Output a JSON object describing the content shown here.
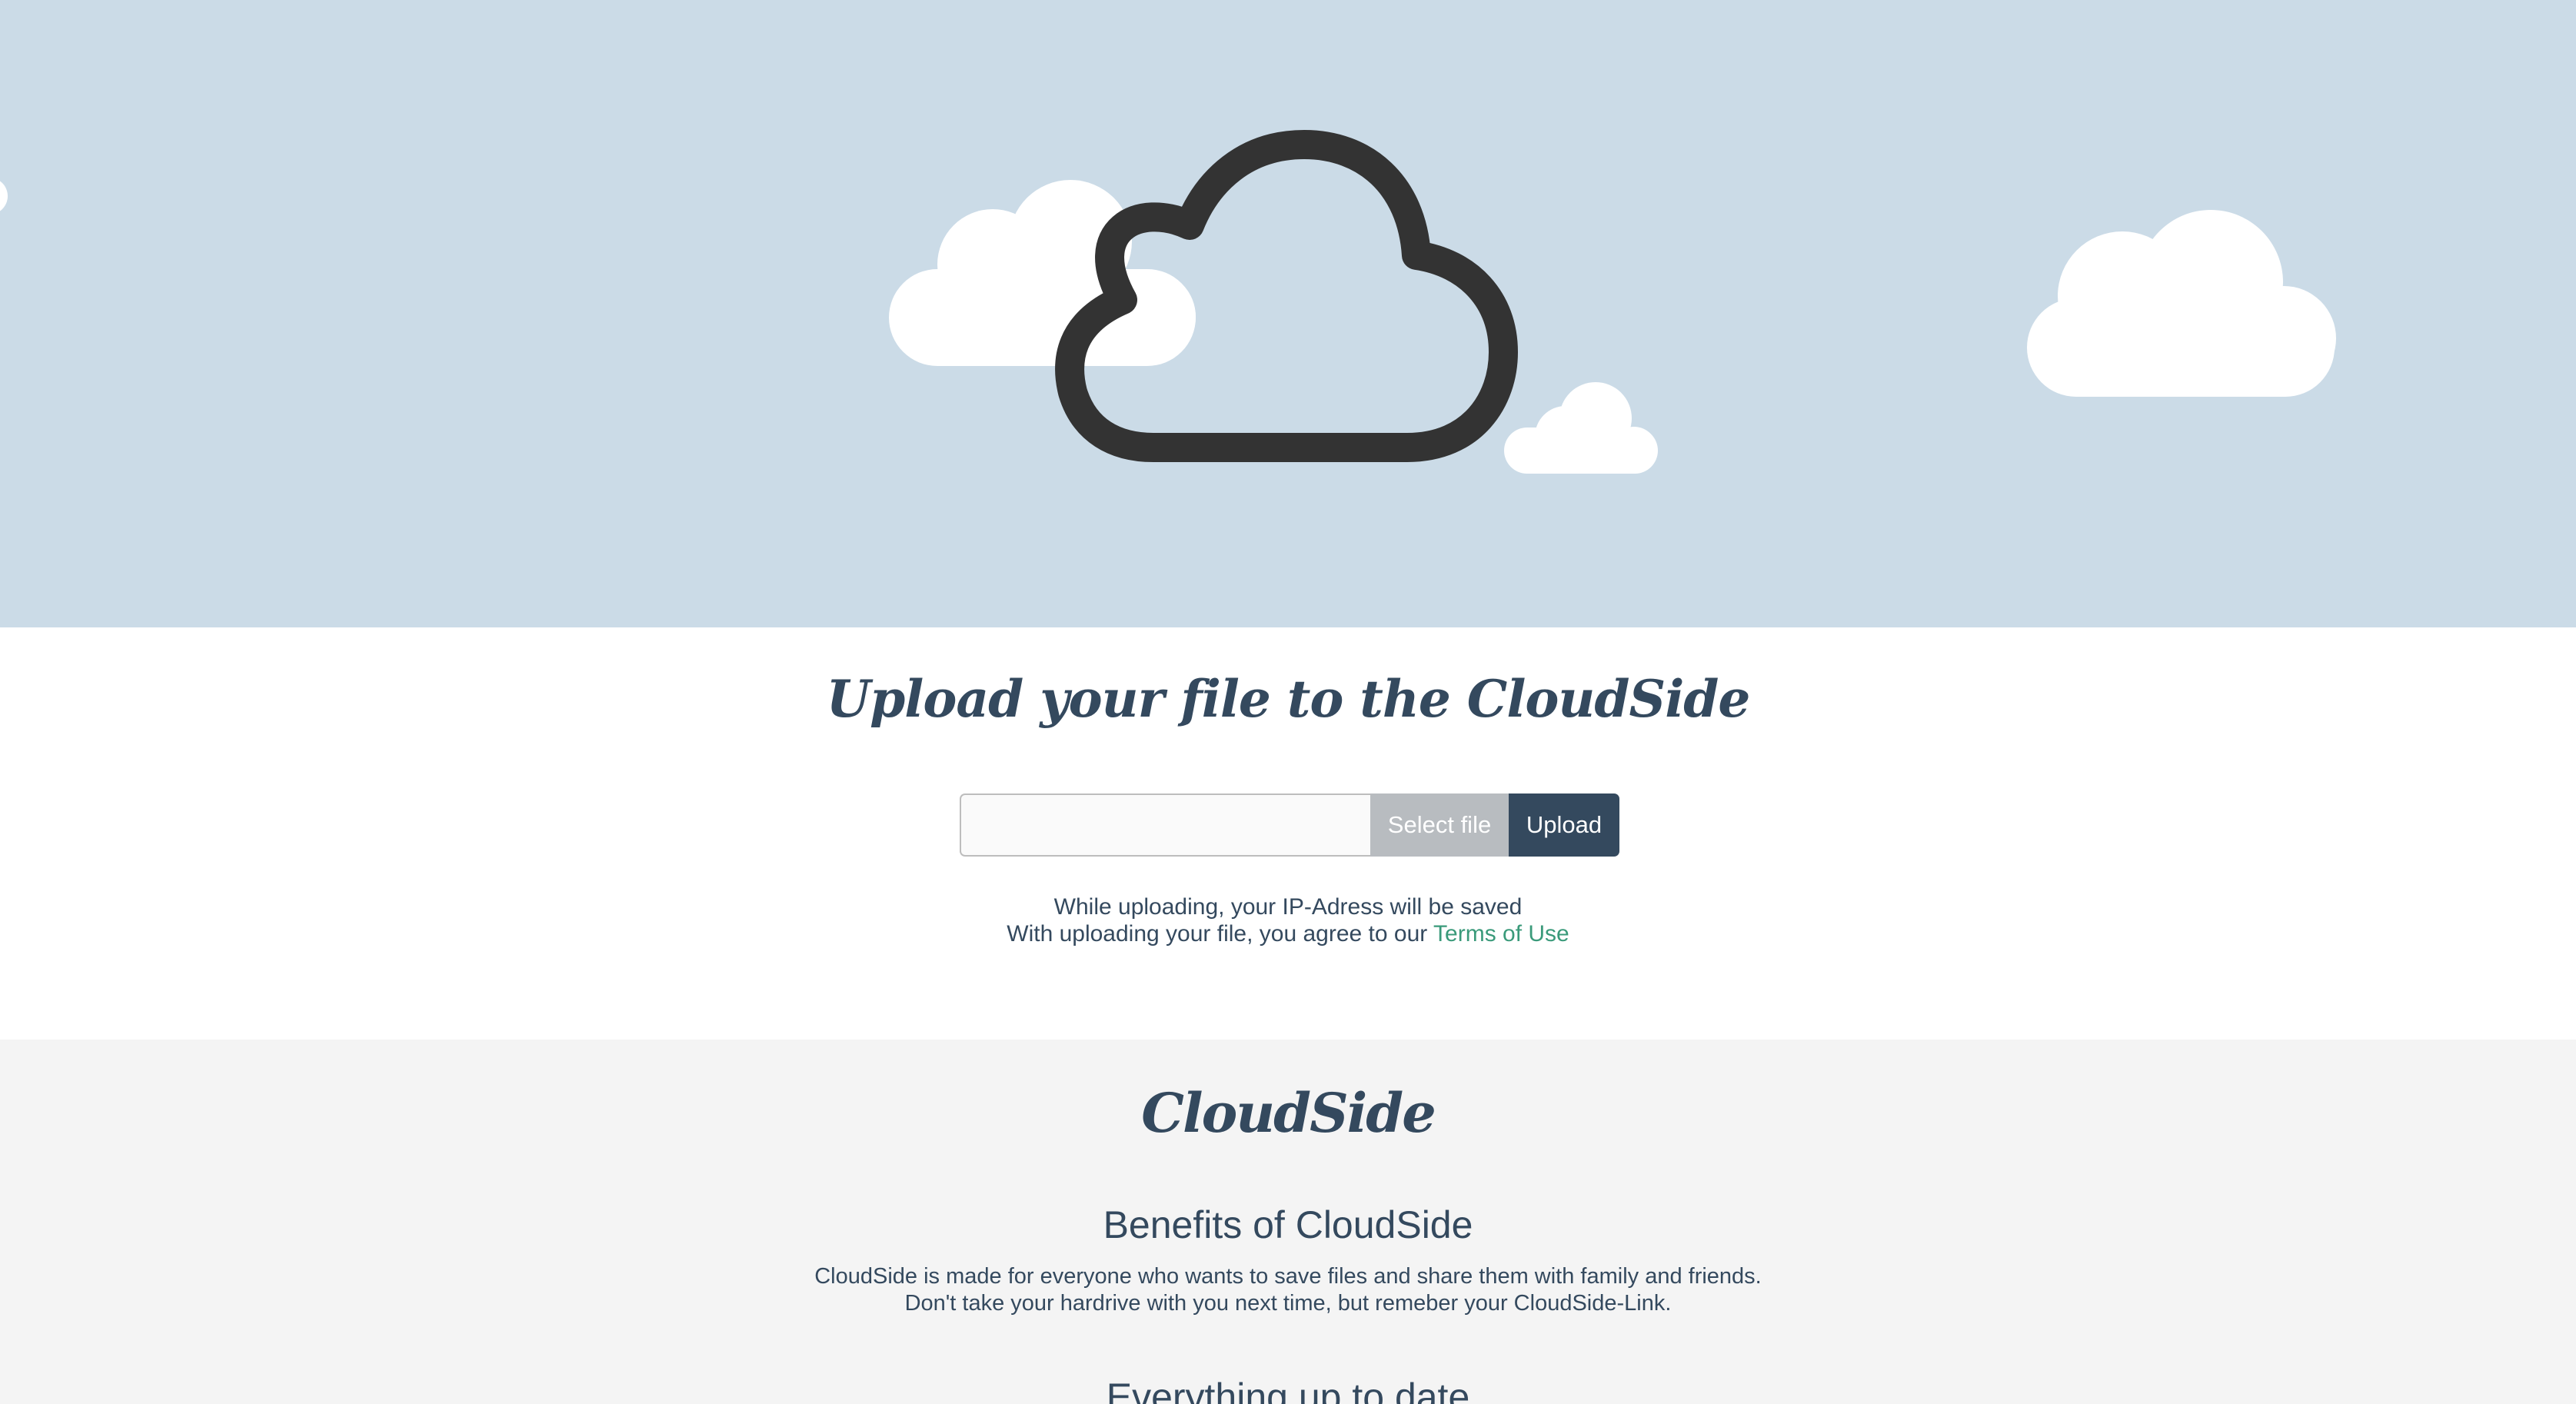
{
  "hero": {
    "logo_icon": "cloud-outline-icon",
    "background_color": "#cbdbe7",
    "decorations": [
      "cloud-icon",
      "cloud-icon",
      "cloud-icon",
      "cloud-icon"
    ]
  },
  "upload": {
    "title": "Upload your file to the CloudSide",
    "file_input_placeholder": "",
    "select_file_label": "Select file",
    "upload_label": "Upload",
    "notice_line1": "While uploading, your IP-Adress will be saved",
    "notice_line2_prefix": "With uploading your file, you agree to our ",
    "terms_link": "Terms of Use"
  },
  "info": {
    "brand": "CloudSide",
    "benefits_heading": "Benefits of CloudSide",
    "benefits_line1": "CloudSide is made for everyone who wants to save files and share them with family and friends.",
    "benefits_line2": "Don't take your hardrive with you next time, but remeber your CloudSide-Link.",
    "next_heading": "Everything up to date"
  },
  "colors": {
    "primary": "#34495e",
    "link": "#3a9a7a",
    "select_button": "#b8bcc0",
    "section_bg": "#f4f4f4"
  }
}
